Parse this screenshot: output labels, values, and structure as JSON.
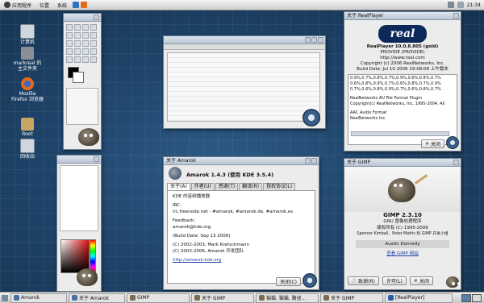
{
  "top_panel": {
    "menu_apps": "应用程序",
    "menu_places": "位置",
    "menu_system": "系统",
    "clock": "21:34"
  },
  "desktop_icons": [
    {
      "label": "计算机",
      "icon": "computer-icon",
      "color": "#cfd6de"
    },
    {
      "label": "markreal 的主文件夹",
      "icon": "home-folder-icon",
      "color": "#8a8f96"
    },
    {
      "label": "Mozilla Firefox 浏览器",
      "icon": "firefox-icon",
      "color": "#e46a1a"
    },
    {
      "label": "Root",
      "icon": "folder-icon",
      "color": "#c9a463"
    },
    {
      "label": "回收站",
      "icon": "trash-icon",
      "color": "#cfd6de"
    }
  ],
  "realplayer": {
    "title": "关于 RealPlayer",
    "logo_text": "real",
    "product": "RealPlayer 10.0.8.805 (gold)",
    "build": "PROVIDE (PROVIDE)",
    "url": "http://www.real.com",
    "copyright": "Copyright (c) 2006 RealNetworks, Inc.",
    "build_date": "Build Date: Jul 10 2006 19:08:08 上午版本",
    "codes": [
      "0.9%,0.7%,0.8%,0.7%,0.9%,0.6%,0.8%,0.7%",
      "0.6%,0.8%,0.9%,0.7%,0.6%,0.8%,0.7%,0.9%",
      "0.7%,0.6%,0.8%,0.9%,0.7%,0.6%,0.8%,0.7%"
    ],
    "plugin1_title": "RealNetworks AU File Format Plugin",
    "plugin1_copy": "Copyright(c) RealNetworks, Inc. 1995-2004. All",
    "plugin2_title": "AAC Audio Format",
    "plugin2_copy": "RealNetworks Inc.",
    "close_label": "关闭"
  },
  "amarok": {
    "title": "关于 Amarok",
    "heading": "Amarok 1.4.3 (使用 KDE 3.5.4)",
    "tabs": [
      "关于(A)",
      "作者(U)",
      "感谢(T)",
      "翻译(R)",
      "授权协议(L)"
    ],
    "lines": [
      "KDE 的音频播放器",
      "IRC:",
      "irc.freenode.net - #amarok, #amarok.de, #amarok.es",
      "Feedback:",
      "amarok@kde.org",
      "(Build Date: Sep 13 2006)",
      "(C) 2002-2003, Mark Kretschmann",
      "(C) 2003-2006, Amarok 开发团队"
    ],
    "link": "http://amarok.kde.org",
    "close_label": "关闭(C)"
  },
  "gimp": {
    "title": "关于 GIMP",
    "version": "GIMP 2.3.10",
    "subtitle": "GNU 图像处理程序",
    "copyright": "版权所有 (C) 1995-2006",
    "authors": "Spencer Kimball、Peter Mattis 和 GIMP 开发小组",
    "scroller": "Austin Donnelly",
    "link": "查看 GIMP 网站",
    "credits_label": "致谢(R)",
    "license_label": "许可(L)",
    "close_label": "关闭"
  },
  "taskbar": {
    "items": [
      {
        "label": "Amarok",
        "color": "#4a6fa0"
      },
      {
        "label": "关于 Amarok",
        "color": "#4a6fa0"
      },
      {
        "label": "GIMP",
        "color": "#7a6b52"
      },
      {
        "label": "关于 GIMP",
        "color": "#7a6b52"
      },
      {
        "label": "猫猫, 猫猫, 路径...",
        "color": "#7a6b52"
      },
      {
        "label": "关于 GIMP",
        "color": "#7a6b52"
      },
      {
        "label": "[RealPlayer]",
        "color": "#2a5aa0"
      }
    ]
  }
}
